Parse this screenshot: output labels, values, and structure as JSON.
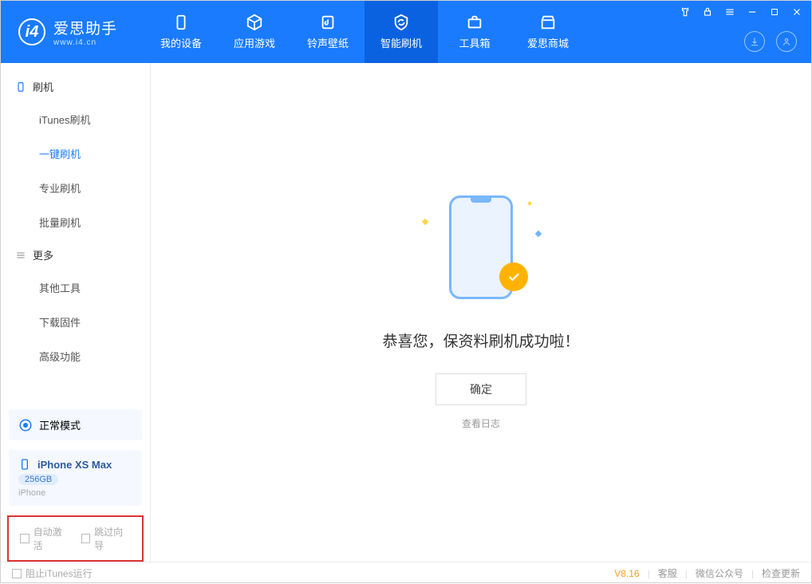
{
  "logo": {
    "title": "爱思助手",
    "subtitle": "www.i4.cn"
  },
  "nav": {
    "tabs": [
      {
        "label": "我的设备"
      },
      {
        "label": "应用游戏"
      },
      {
        "label": "铃声壁纸"
      },
      {
        "label": "智能刷机"
      },
      {
        "label": "工具箱"
      },
      {
        "label": "爱思商城"
      }
    ]
  },
  "sidebar": {
    "group1_title": "刷机",
    "group1_items": [
      "iTunes刷机",
      "一键刷机",
      "专业刷机",
      "批量刷机"
    ],
    "group2_title": "更多",
    "group2_items": [
      "其他工具",
      "下载固件",
      "高级功能"
    ],
    "mode_label": "正常模式",
    "device": {
      "name": "iPhone XS Max",
      "storage": "256GB",
      "type": "iPhone"
    },
    "checkbox1": "自动激活",
    "checkbox2": "跳过向导"
  },
  "main": {
    "success_message": "恭喜您，保资料刷机成功啦！",
    "ok_button": "确定",
    "view_log": "查看日志"
  },
  "footer": {
    "block_itunes": "阻止iTunes运行",
    "version": "V8.16",
    "link1": "客服",
    "link2": "微信公众号",
    "link3": "检查更新"
  }
}
